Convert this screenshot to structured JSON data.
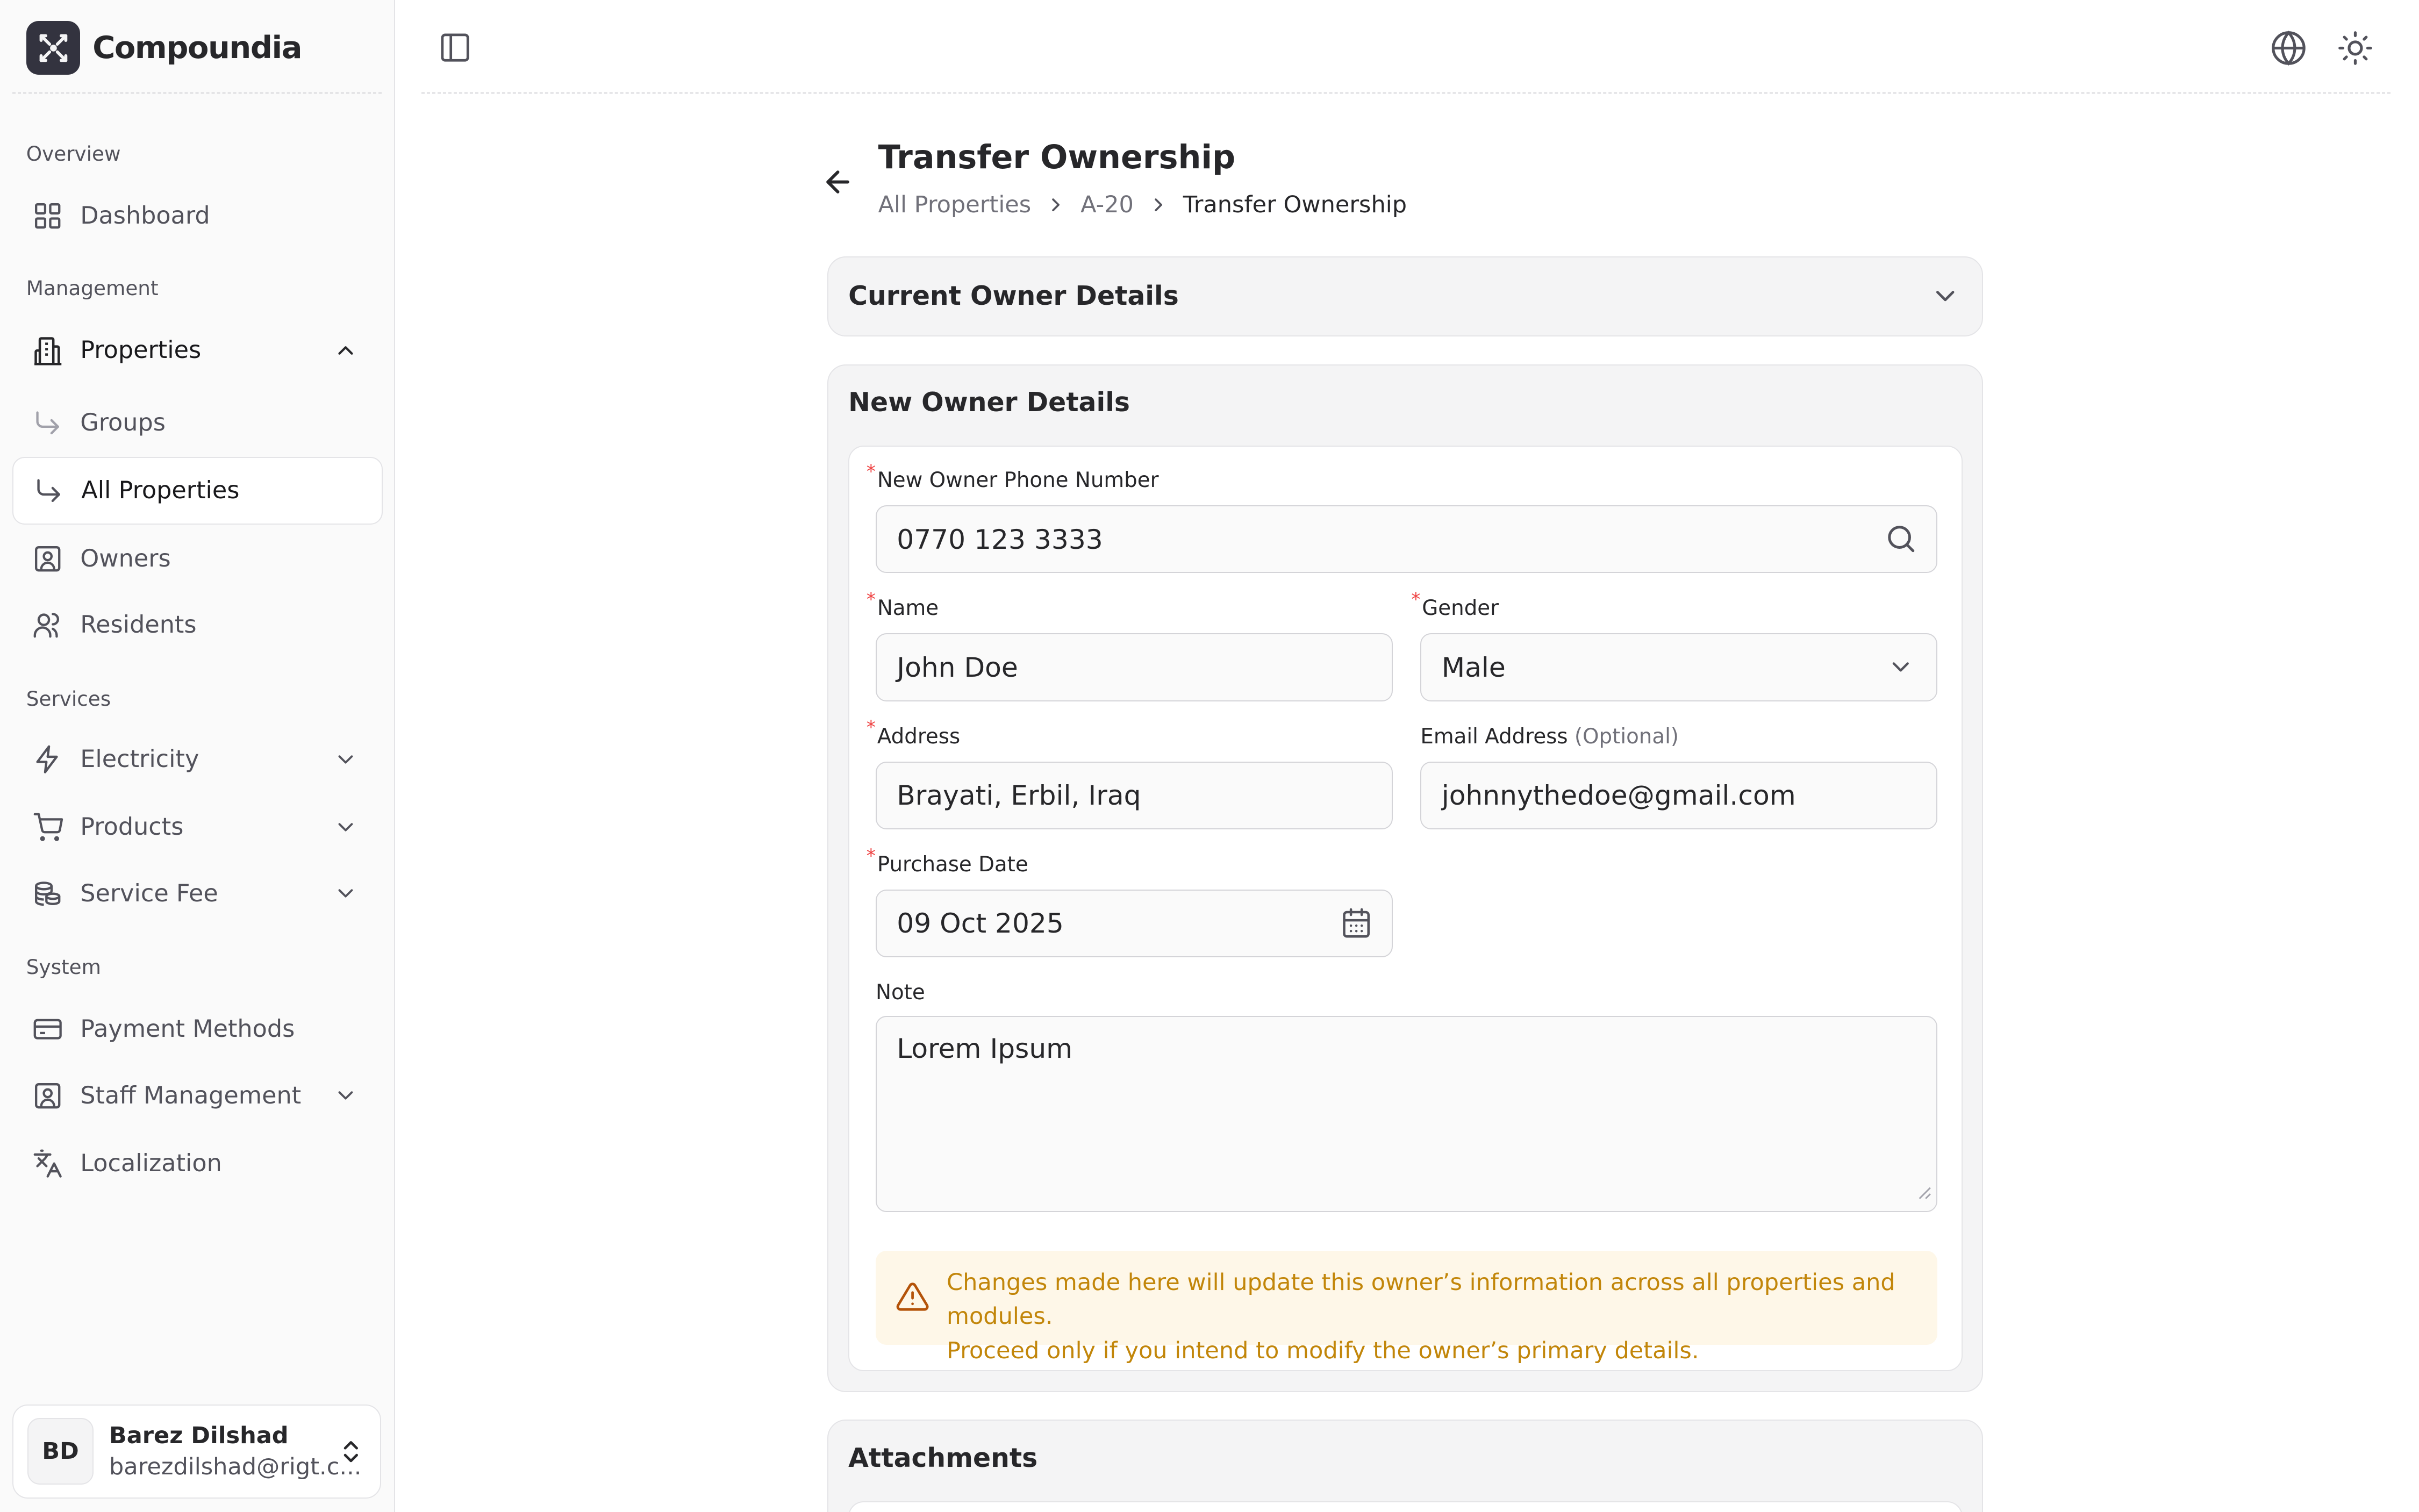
{
  "brand": {
    "name": "Compoundia"
  },
  "sidebar": {
    "sections": {
      "overview": "Overview",
      "management": "Management",
      "services": "Services",
      "system": "System"
    },
    "items": {
      "dashboard": "Dashboard",
      "properties": "Properties",
      "groups": "Groups",
      "all_properties": "All Properties",
      "owners": "Owners",
      "residents": "Residents",
      "electricity": "Electricity",
      "products": "Products",
      "service_fee": "Service Fee",
      "payment_methods": "Payment Methods",
      "staff_management": "Staff Management",
      "localization": "Localization"
    },
    "active_item": "All Properties"
  },
  "user": {
    "initials": "BD",
    "name": "Barez Dilshad",
    "email": "barezdilshad@rigt.c..."
  },
  "header": {
    "title": "Transfer Ownership",
    "breadcrumb": [
      "All Properties",
      "A-20",
      "Transfer Ownership"
    ]
  },
  "current_owner": {
    "title": "Current Owner Details",
    "collapsed": true
  },
  "new_owner": {
    "title": "New Owner Details",
    "phone": {
      "label": "New Owner Phone Number",
      "value": "0770 123 3333"
    },
    "name": {
      "label": "Name",
      "value": "John Doe"
    },
    "gender": {
      "label": "Gender",
      "value": "Male"
    },
    "address": {
      "label": "Address",
      "value": "Brayati, Erbil, Iraq"
    },
    "email": {
      "label": "Email Address",
      "optional": "(Optional)",
      "value": "johnnythedoe@gmail.com"
    },
    "purchase_date": {
      "label": "Purchase Date",
      "value": "09 Oct 2025"
    },
    "note": {
      "label": "Note",
      "value": "Lorem Ipsum"
    },
    "warning": {
      "line1": "Changes made here will update this owner’s information across all properties and modules.",
      "line2": "Proceed only if you intend to modify the owner’s primary details."
    }
  },
  "attachments": {
    "title": "Attachments"
  },
  "colors": {
    "accent": "#27272a",
    "warning_bg": "#fef7e8",
    "warning_text": "#c2860a",
    "required": "#ef4444"
  }
}
